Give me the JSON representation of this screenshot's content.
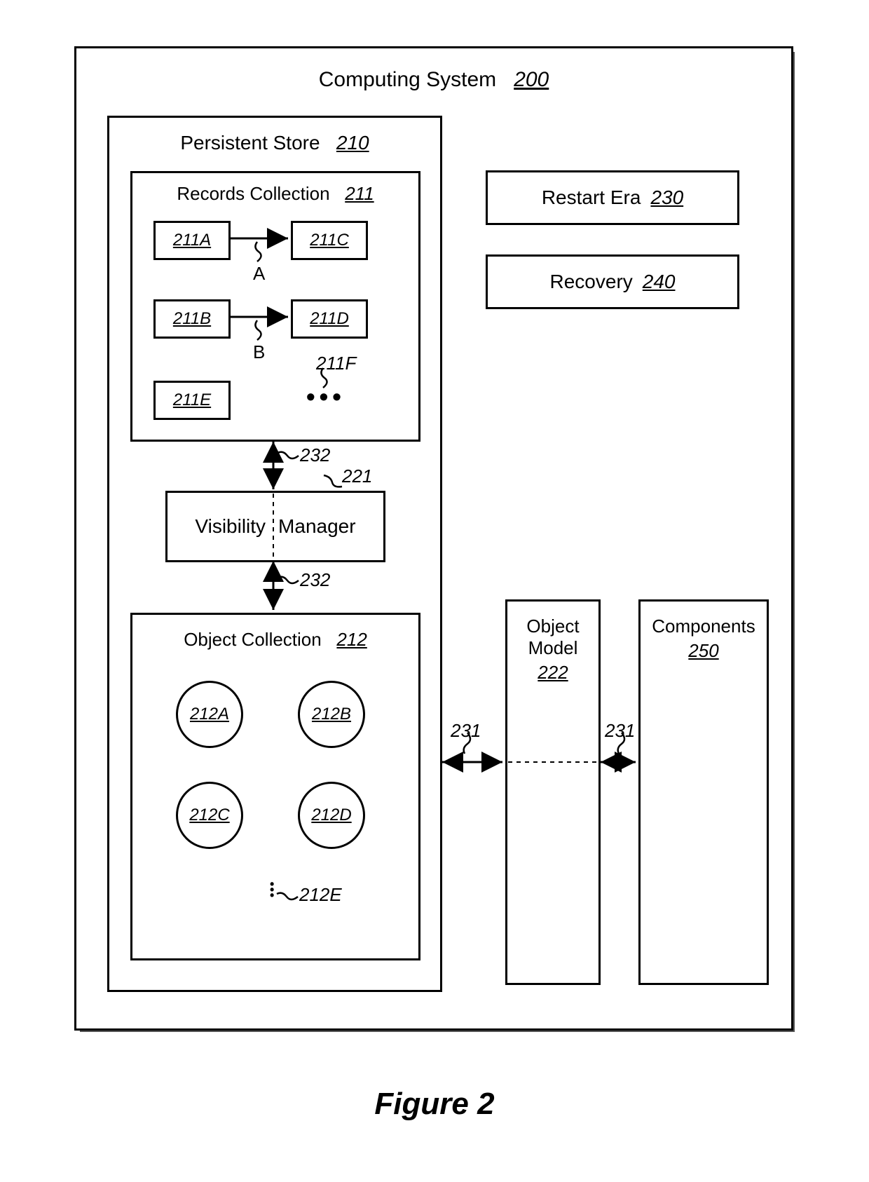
{
  "title": {
    "label": "Computing System",
    "num": "200"
  },
  "persistent_store": {
    "label": "Persistent Store",
    "num": "210"
  },
  "records_collection": {
    "label": "Records Collection",
    "num": "211"
  },
  "records": {
    "a": "211A",
    "b": "211B",
    "c": "211C",
    "d": "211D",
    "e": "211E",
    "f_more": "211F"
  },
  "arrow_labels": {
    "a": "A",
    "b": "B"
  },
  "visibility_manager": {
    "left": "Visibility",
    "right": "Manager",
    "num": "221"
  },
  "vis_arrows": {
    "top": "232",
    "bottom": "232"
  },
  "object_collection": {
    "label": "Object Collection",
    "num": "212"
  },
  "objects": {
    "a": "212A",
    "b": "212B",
    "c": "212C",
    "d": "212D",
    "e_more": "212E"
  },
  "restart_era": {
    "label": "Restart  Era",
    "num": "230"
  },
  "recovery": {
    "label": "Recovery",
    "num": "240"
  },
  "object_model": {
    "label1": "Object",
    "label2": "Model",
    "num": "222"
  },
  "components": {
    "label": "Components",
    "num": "250"
  },
  "horiz_arrows": {
    "left": "231",
    "right": "231"
  },
  "figure_caption": "Figure 2"
}
